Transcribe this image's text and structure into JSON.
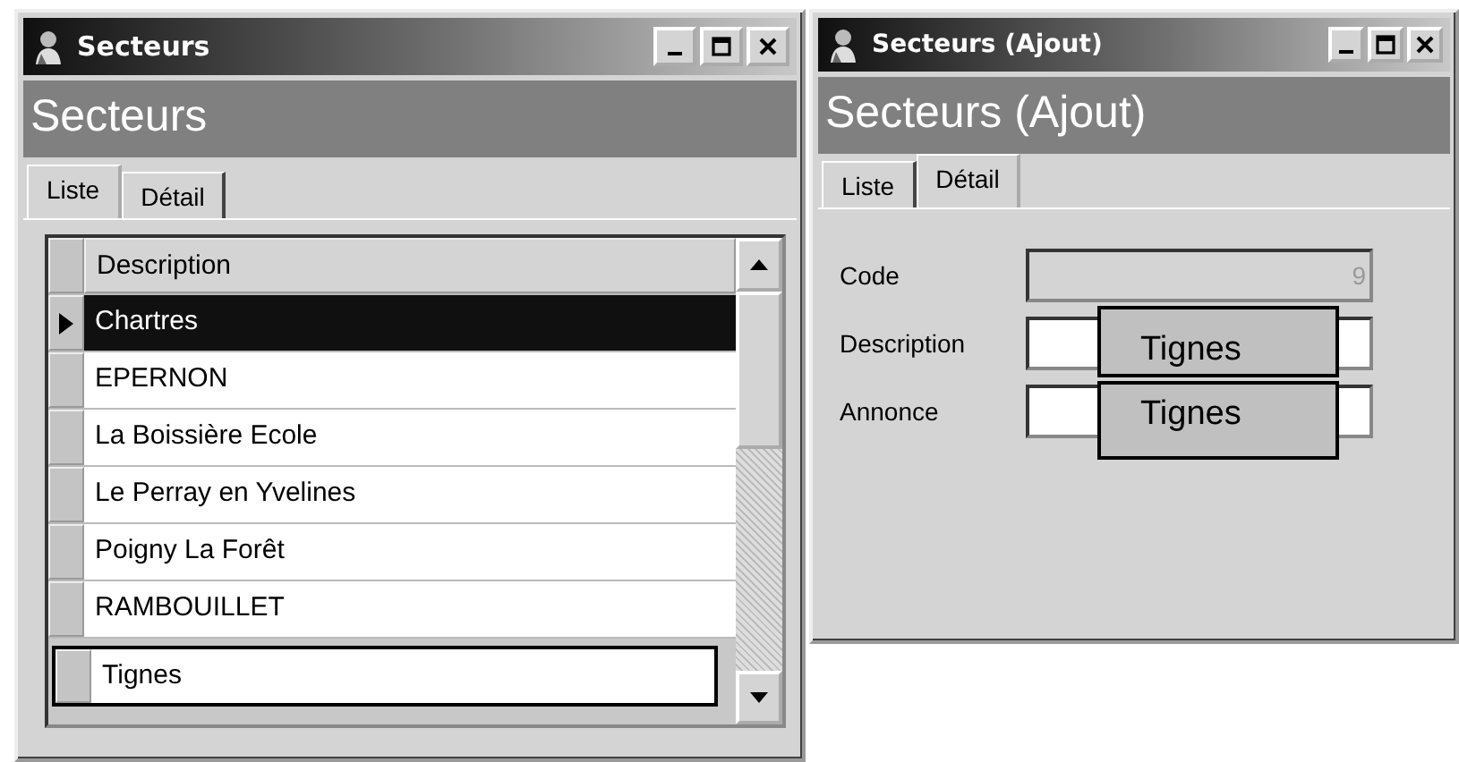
{
  "windows": [
    {
      "title": "Secteurs",
      "header": "Secteurs",
      "tabs": [
        {
          "label": "Liste",
          "selected": true
        },
        {
          "label": "Détail",
          "selected": false
        }
      ],
      "grid": {
        "columns": [
          "Description"
        ],
        "rows": [
          {
            "description": "Chartres",
            "selected": true,
            "outlined": false
          },
          {
            "description": "EPERNON",
            "selected": false,
            "outlined": false
          },
          {
            "description": "La Boissière Ecole",
            "selected": false,
            "outlined": false
          },
          {
            "description": "Le Perray en Yvelines",
            "selected": false,
            "outlined": false
          },
          {
            "description": "Poigny La Forêt",
            "selected": false,
            "outlined": false
          },
          {
            "description": "RAMBOUILLET",
            "selected": false,
            "outlined": false
          },
          {
            "description": "Tignes",
            "selected": false,
            "outlined": true
          }
        ]
      }
    },
    {
      "title": "Secteurs (Ajout)",
      "header": "Secteurs (Ajout)",
      "tabs": [
        {
          "label": "Liste",
          "selected": false
        },
        {
          "label": "Détail",
          "selected": true
        }
      ],
      "fields": [
        {
          "label": "Code",
          "value": "9",
          "disabled": true
        },
        {
          "label": "Description",
          "disabled": false,
          "callout": "Tignes"
        },
        {
          "label": "Annonce",
          "disabled": false,
          "callout": "Tignes"
        }
      ]
    }
  ]
}
